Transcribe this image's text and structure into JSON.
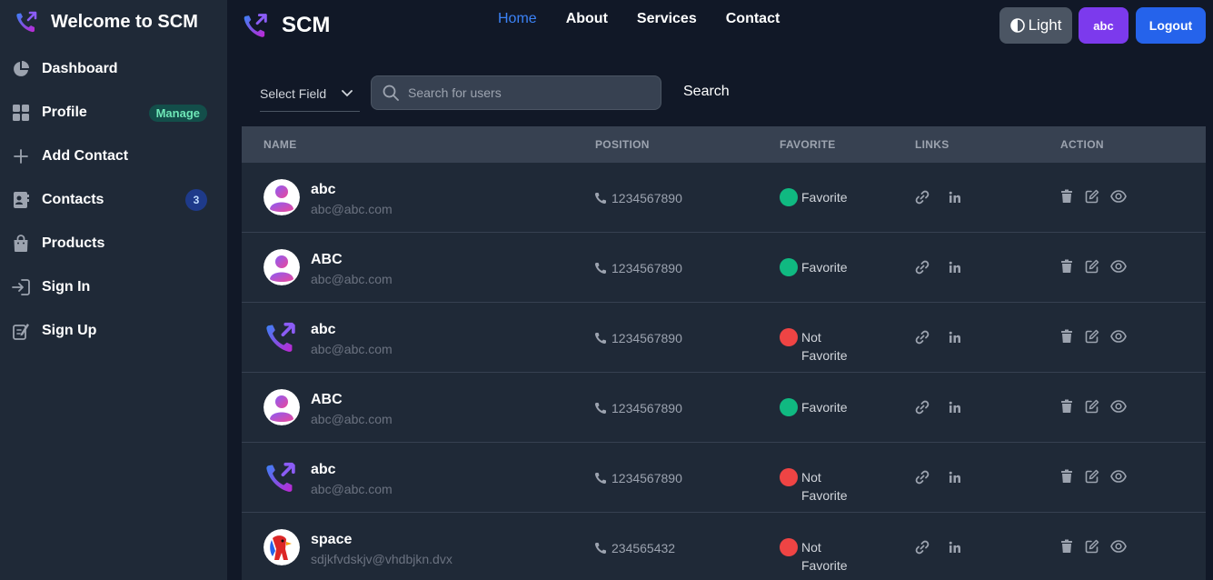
{
  "sidebar": {
    "brand": "Welcome to SCM",
    "items": [
      {
        "label": "Dashboard",
        "icon": "pie-chart-icon"
      },
      {
        "label": "Profile",
        "icon": "grid-icon",
        "badge": "Manage"
      },
      {
        "label": "Add Contact",
        "icon": "plus-icon"
      },
      {
        "label": "Contacts",
        "icon": "contact-card-icon",
        "badge": "3"
      },
      {
        "label": "Products",
        "icon": "shopping-bag-icon"
      },
      {
        "label": "Sign In",
        "icon": "sign-in-icon"
      },
      {
        "label": "Sign Up",
        "icon": "sign-up-icon"
      }
    ]
  },
  "header": {
    "brand": "SCM",
    "nav": [
      "Home",
      "About",
      "Services",
      "Contact"
    ],
    "theme_label": "Light",
    "user_label": "abc",
    "logout_label": "Logout"
  },
  "search": {
    "select_label": "Select Field",
    "placeholder": "Search for users",
    "button_label": "Search"
  },
  "table": {
    "columns": [
      "NAME",
      "POSITION",
      "FAVORITE",
      "LINKS",
      "ACTION"
    ],
    "rows": [
      {
        "name": "abc",
        "email": "abc@abc.com",
        "phone": "1234567890",
        "favorite": "Favorite",
        "avatar": "person"
      },
      {
        "name": "ABC",
        "email": "abc@abc.com",
        "phone": "1234567890",
        "favorite": "Favorite",
        "avatar": "person"
      },
      {
        "name": "abc",
        "email": "abc@abc.com",
        "phone": "1234567890",
        "favorite": "Not Favorite",
        "avatar": "logo"
      },
      {
        "name": "ABC",
        "email": "abc@abc.com",
        "phone": "1234567890",
        "favorite": "Favorite",
        "avatar": "person"
      },
      {
        "name": "abc",
        "email": "abc@abc.com",
        "phone": "1234567890",
        "favorite": "Not Favorite",
        "avatar": "logo"
      },
      {
        "name": "space",
        "email": "sdjkfvdskjv@vhdbjkn.dvx",
        "phone": "234565432",
        "favorite": "Not Favorite",
        "avatar": "pony"
      }
    ]
  },
  "colors": {
    "favorite": "#10b981",
    "not_favorite": "#ef4444",
    "accent": "#3b82f6"
  }
}
